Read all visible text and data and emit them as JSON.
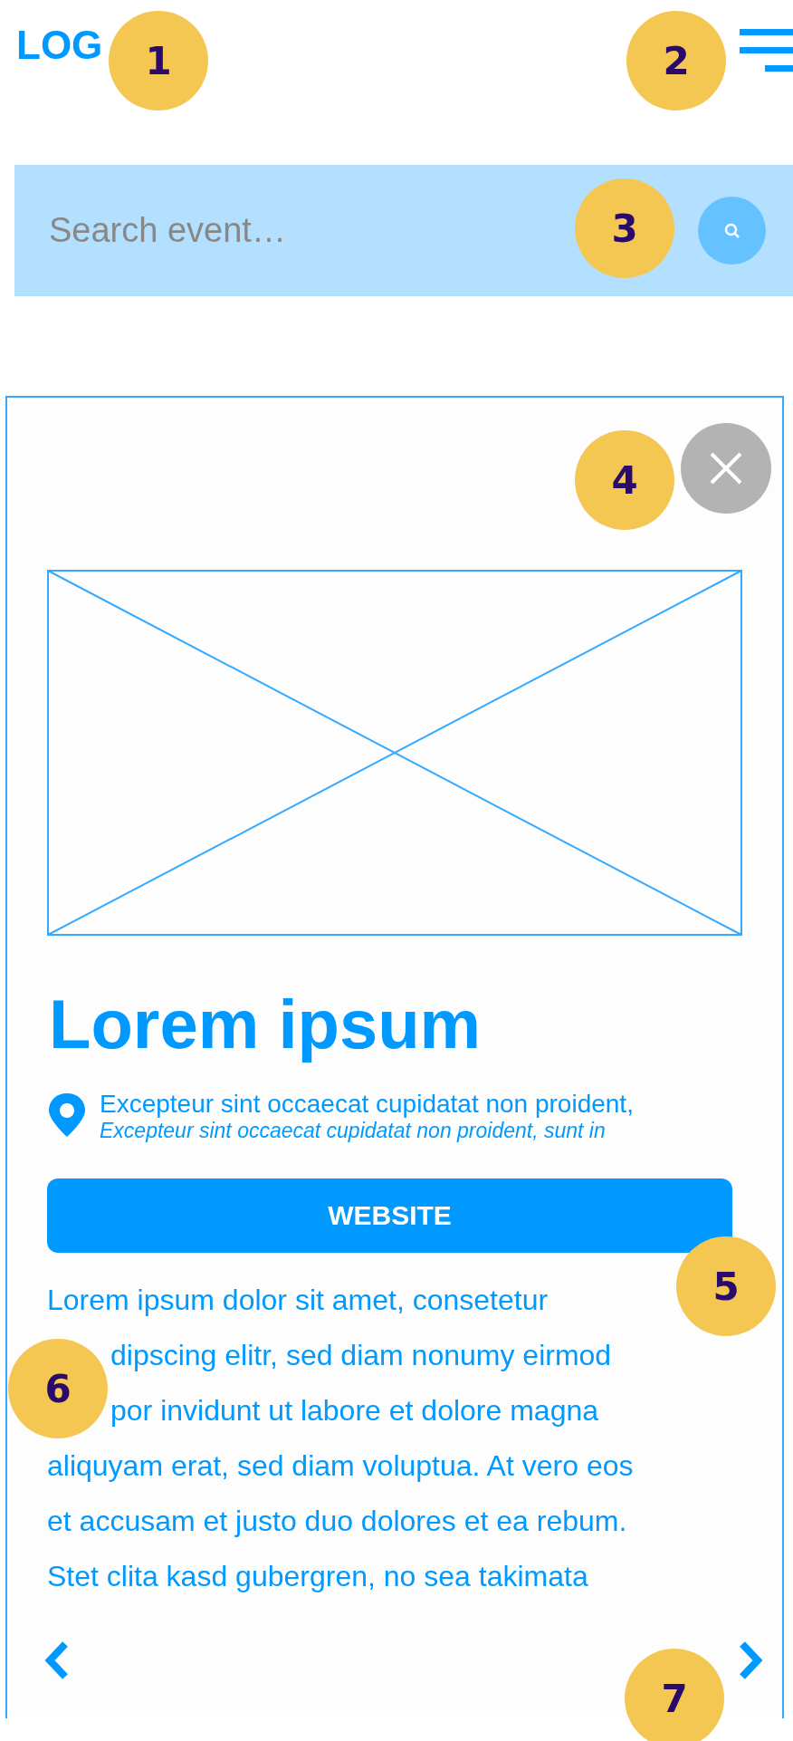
{
  "header": {
    "logo": "LOG"
  },
  "search": {
    "placeholder": "Search event…"
  },
  "event": {
    "title": "Lorem ipsum",
    "location": {
      "line": "Excepteur sint occaecat cupidatat non proident,",
      "detail": "Excepteur sint occaecat cupidatat non proident, sunt in"
    },
    "website_button": "WEBSITE",
    "description_lines": [
      {
        "text": "Lorem ipsum dolor sit amet, consetetur"
      },
      {
        "text": "dipscing elitr, sed diam nonumy eirmod"
      },
      {
        "text": "por invidunt ut labore et dolore magna"
      },
      {
        "text": "aliquyam erat, sed diam voluptua. At vero eos"
      },
      {
        "text": "et accusam et justo duo dolores et ea rebum."
      },
      {
        "text": "Stet clita kasd gubergren, no sea takimata"
      }
    ]
  },
  "badges": [
    "1",
    "2",
    "3",
    "4",
    "5",
    "6",
    "7"
  ]
}
